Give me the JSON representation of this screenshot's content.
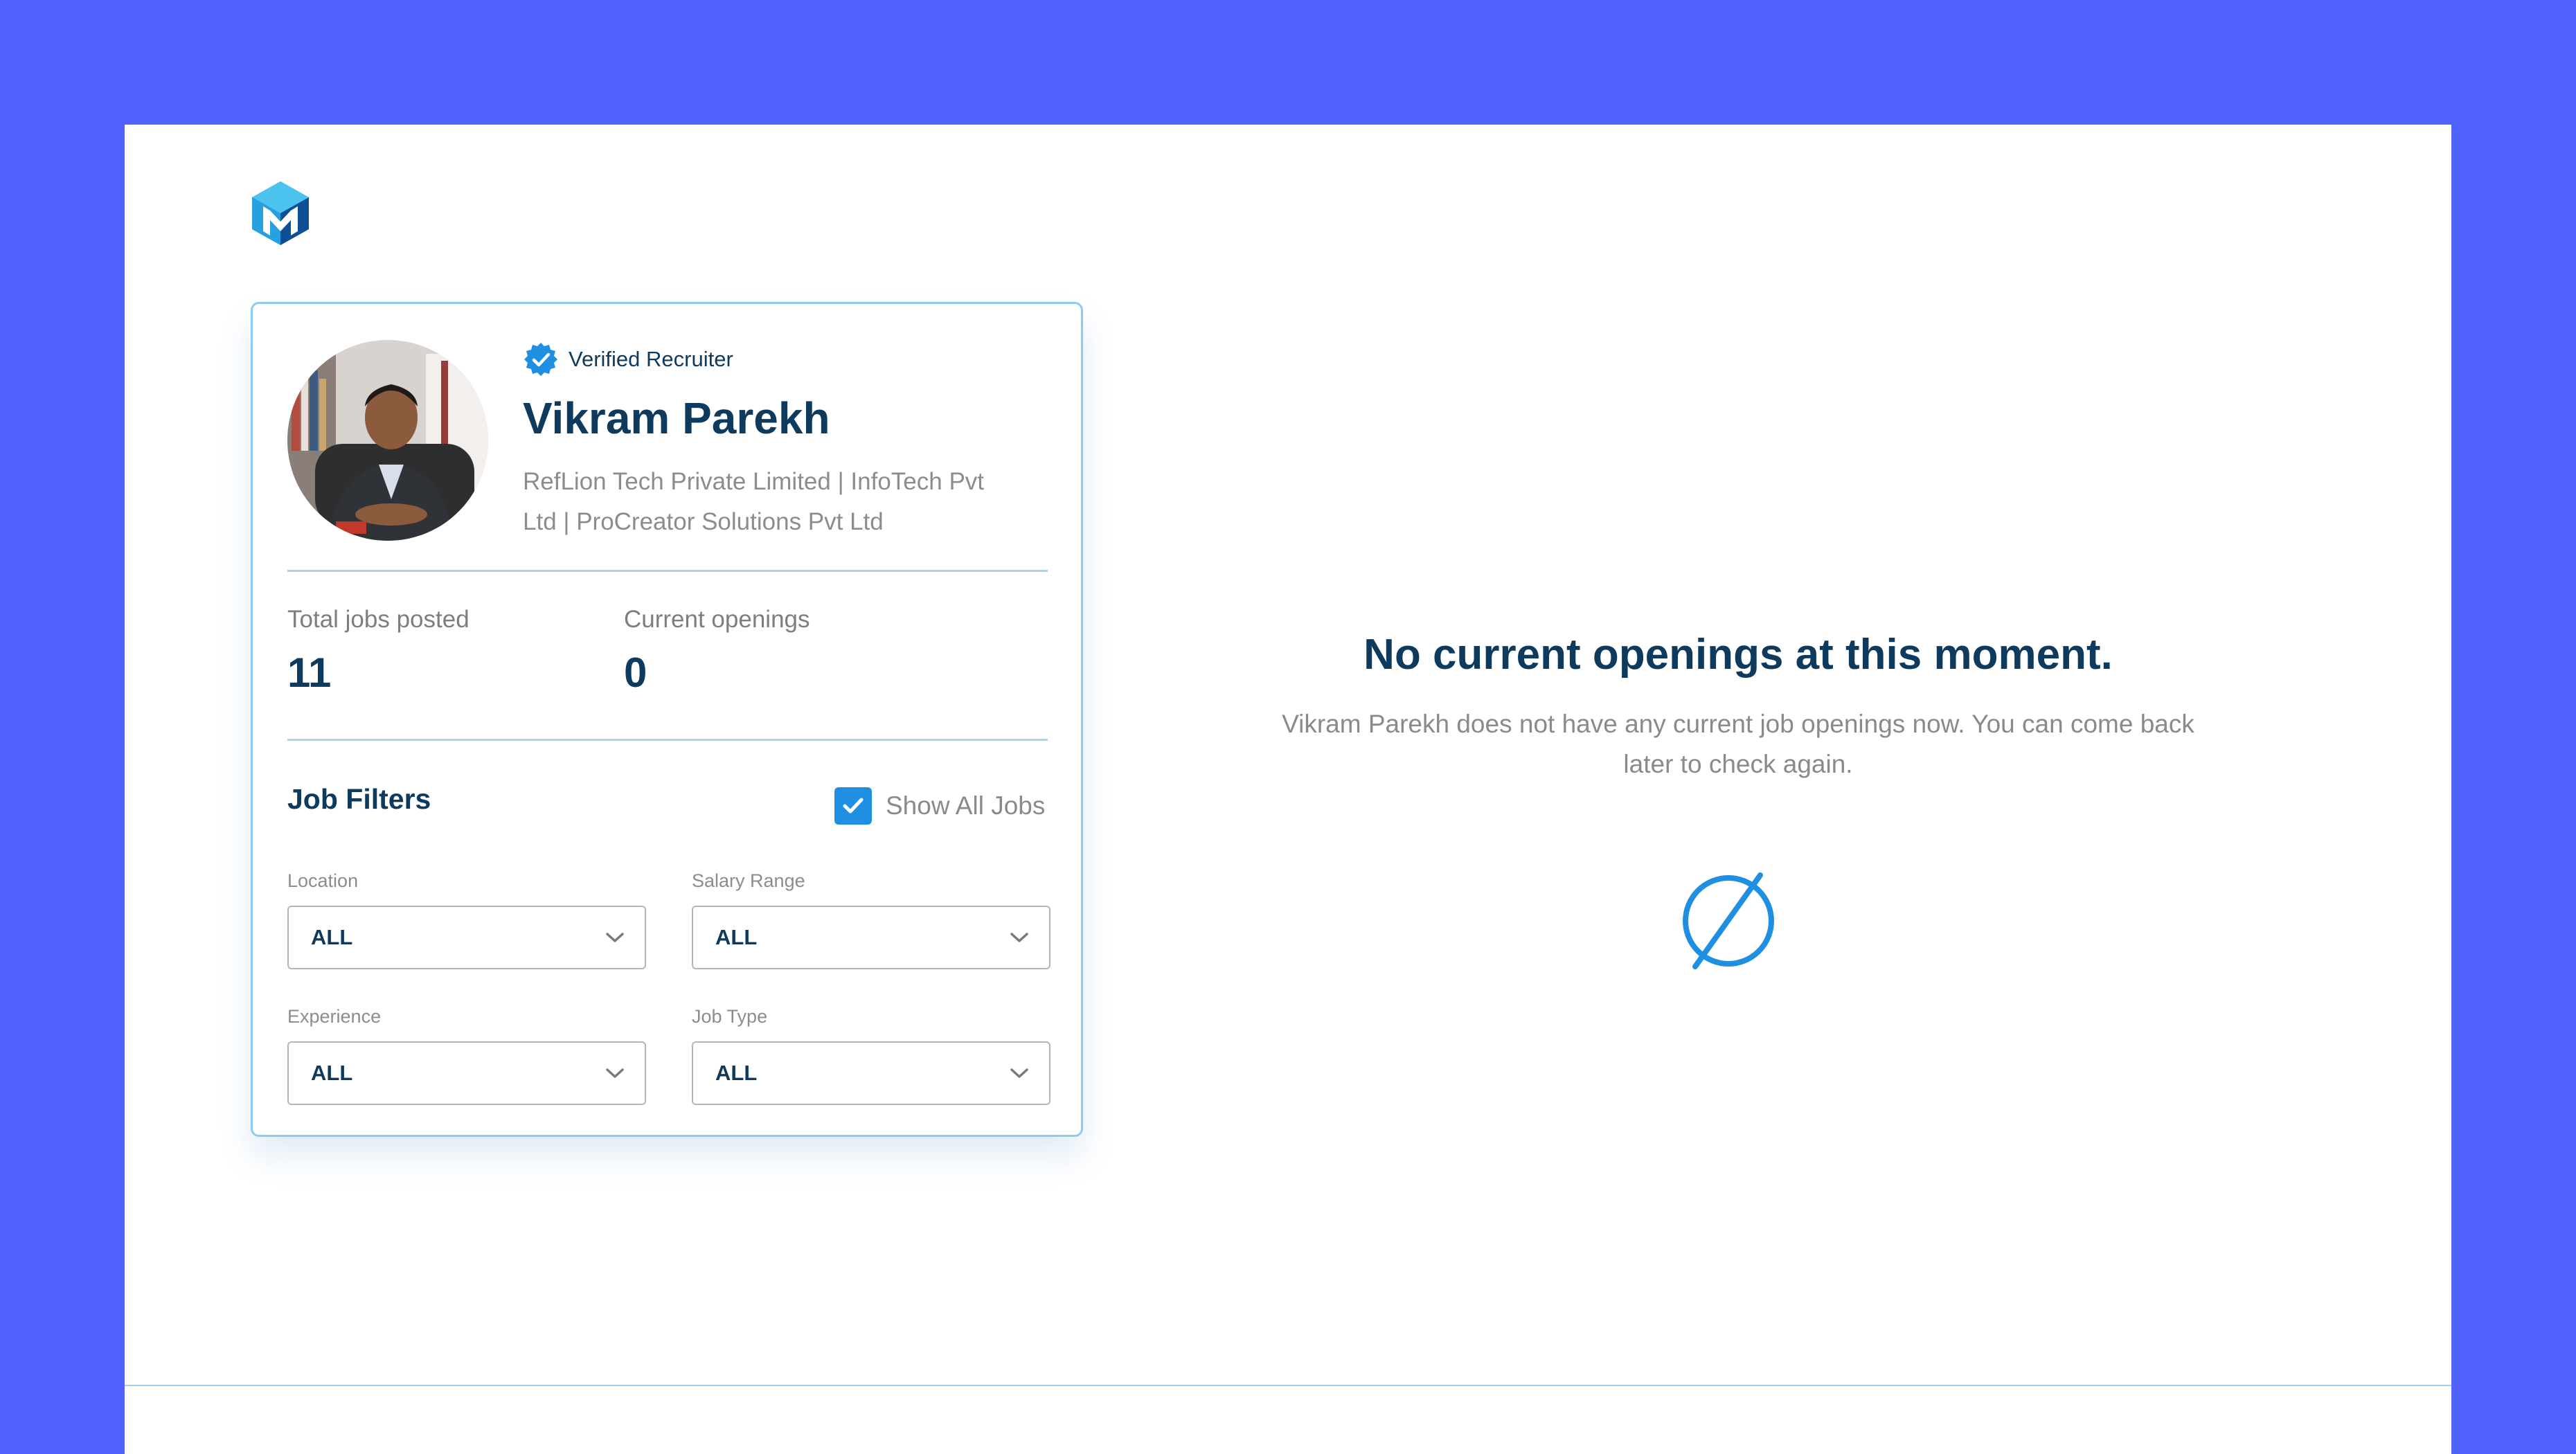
{
  "app": {
    "logo": {
      "icon": "m-cube-logo-icon",
      "colors": [
        "#26A9E0",
        "#1478C8",
        "#0E4E94"
      ]
    }
  },
  "profile": {
    "badge_label": "Verified Recruiter",
    "badge_icon": "verified-badge-icon",
    "name": "Vikram Parekh",
    "company": "RefLion Tech Private Limited | InfoTech Pvt Ltd | ProCreator Solutions Pvt Ltd"
  },
  "stats": {
    "total_label": "Total jobs posted",
    "total_value": "11",
    "openings_label": "Current openings",
    "openings_value": "0"
  },
  "filters": {
    "title": "Job Filters",
    "show_all_label": "Show All Jobs",
    "show_all_checked": true,
    "location": {
      "label": "Location",
      "value": "ALL"
    },
    "salary": {
      "label": "Salary Range",
      "value": "ALL"
    },
    "experience": {
      "label": "Experience",
      "value": "ALL"
    },
    "job_type": {
      "label": "Job Type",
      "value": "ALL"
    }
  },
  "empty_state": {
    "title": "No current openings at this moment.",
    "description": "Vikram Parekh does not have any current job openings now. You can come back later to check again.",
    "icon": "empty-set-icon"
  },
  "colors": {
    "background": "#5064FD",
    "accent": "#1E8FE1",
    "heading": "#0E3A5E",
    "muted_text": "#8A8A8A"
  }
}
